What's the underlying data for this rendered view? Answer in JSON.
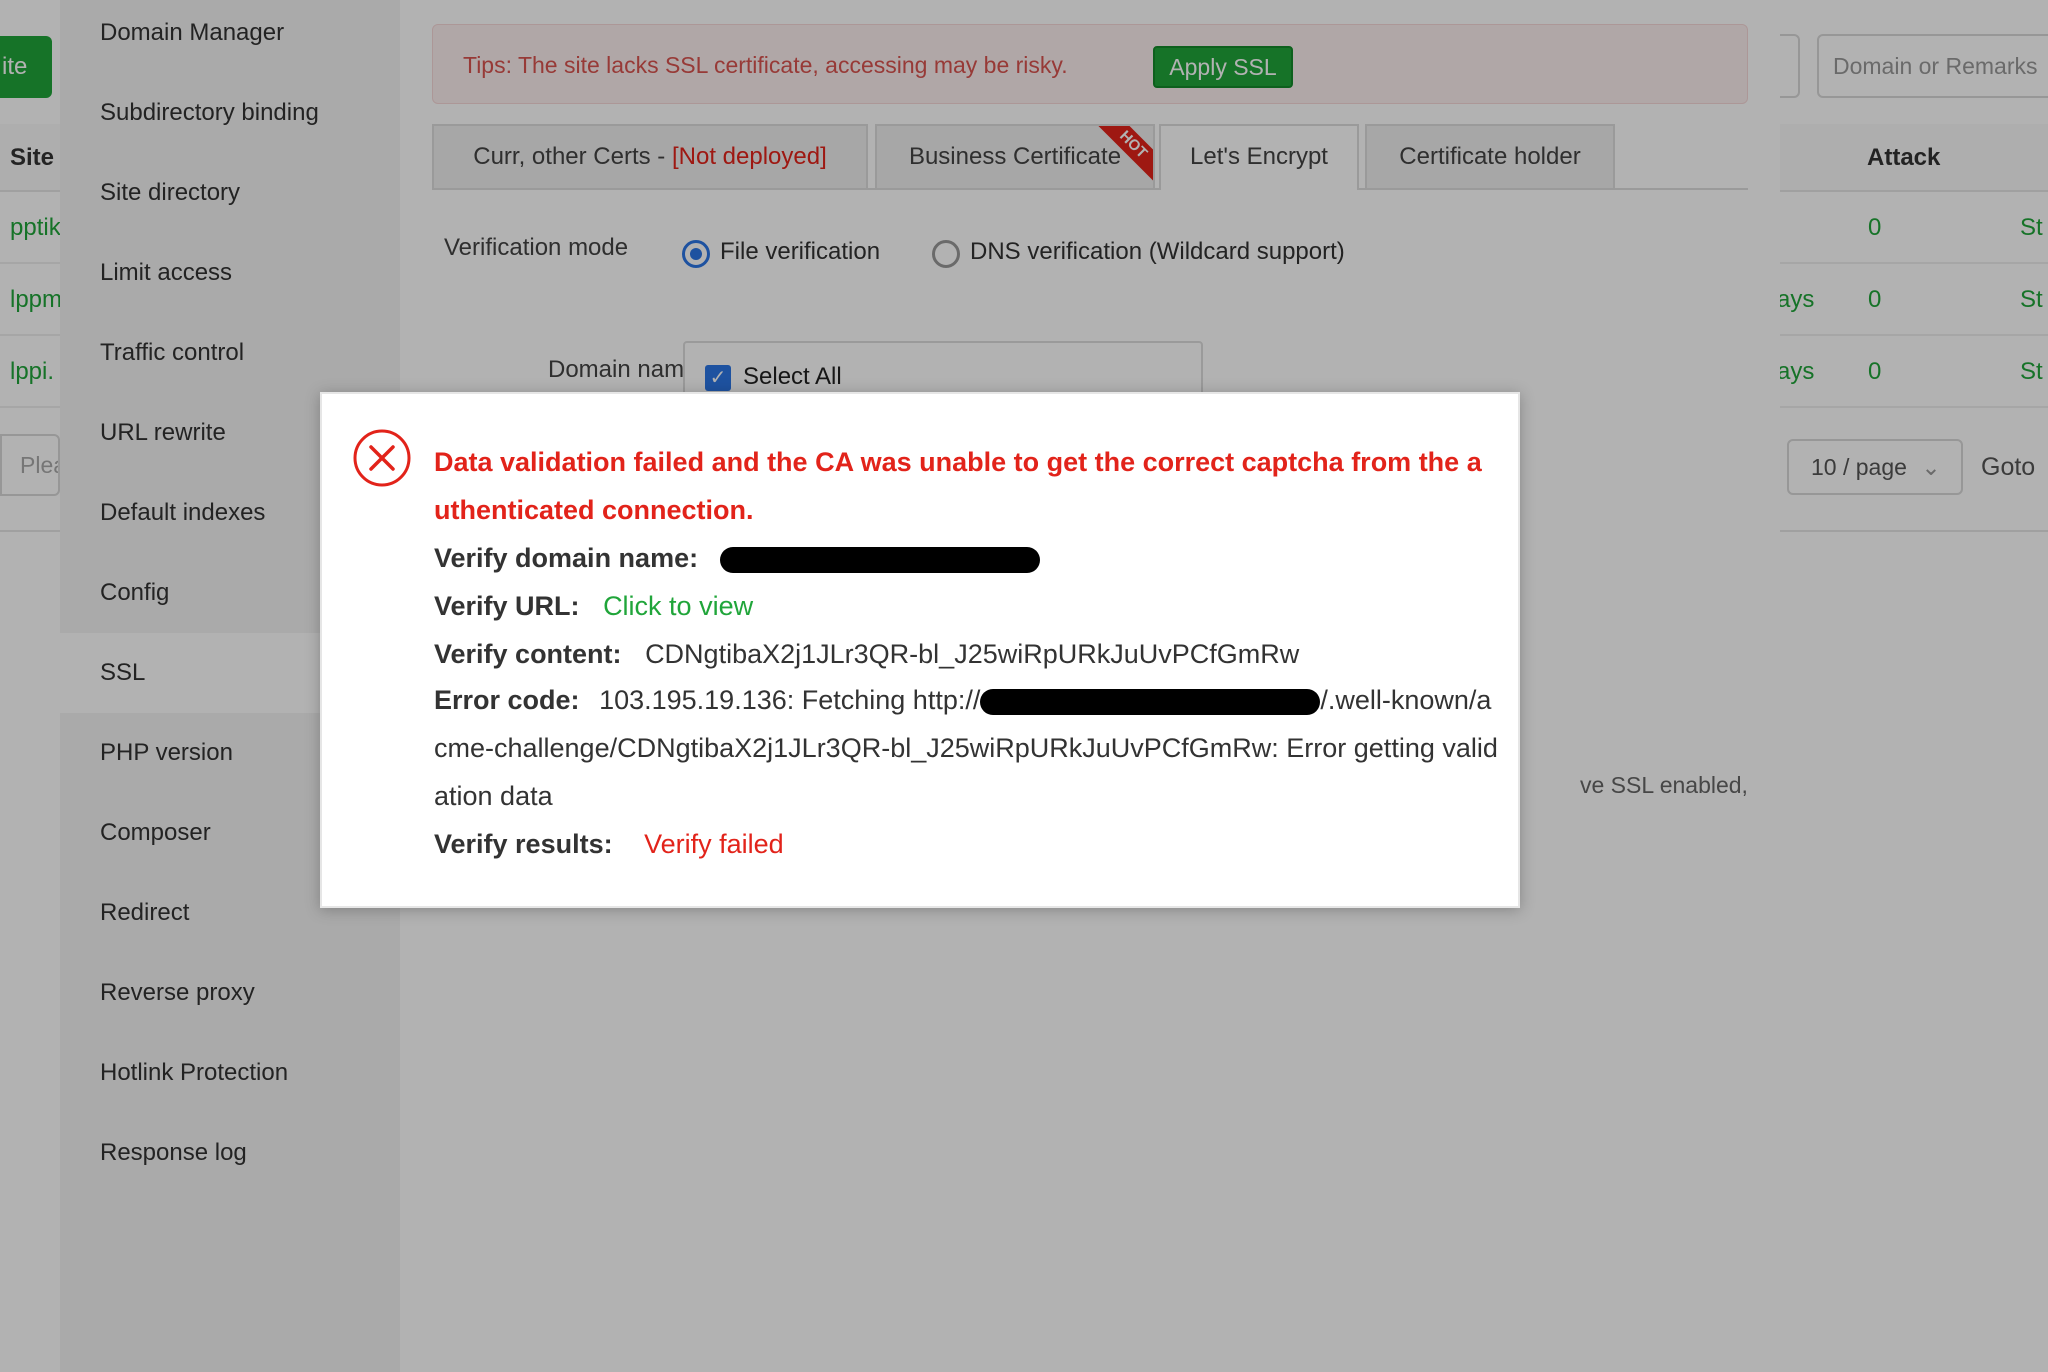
{
  "background": {
    "add_button_label": "ite",
    "search_placeholder": "Domain or Remarks",
    "columns": {
      "site": "Site",
      "attack": "Attack"
    },
    "rows": [
      {
        "site": "pptik",
        "expire": "",
        "attack": "0",
        "status": "St"
      },
      {
        "site": "lppm",
        "expire": "ays",
        "attack": "0",
        "status": "St"
      },
      {
        "site": "lppi.",
        "expire": "ays",
        "attack": "0",
        "status": "St"
      }
    ],
    "pager": {
      "input_placeholder": "Plea",
      "page_size": "10 / page",
      "goto_label": "Goto"
    }
  },
  "sidebar": {
    "items": [
      {
        "label": "Domain Manager"
      },
      {
        "label": "Subdirectory binding"
      },
      {
        "label": "Site directory"
      },
      {
        "label": "Limit access"
      },
      {
        "label": "Traffic control"
      },
      {
        "label": "URL rewrite"
      },
      {
        "label": "Default indexes"
      },
      {
        "label": "Config"
      },
      {
        "label": "SSL"
      },
      {
        "label": "PHP version"
      },
      {
        "label": "Composer"
      },
      {
        "label": "Redirect"
      },
      {
        "label": "Reverse proxy"
      },
      {
        "label": "Hotlink Protection"
      },
      {
        "label": "Response log"
      }
    ],
    "active": "SSL"
  },
  "ssl": {
    "tip_text": "Tips: The site lacks SSL certificate, accessing may be risky.",
    "apply_button": "Apply SSL",
    "tabs": {
      "curr_label": "Curr, other Certs - ",
      "curr_status": "[Not deployed]",
      "business": "Business Certificate",
      "hot_badge": "HOT",
      "letsencrypt": "Let's Encrypt",
      "holder": "Certificate holder"
    },
    "verification_mode_label": "Verification mode",
    "file_verification": "File verification",
    "dns_verification": "DNS verification (Wildcard support)",
    "domain_name_label": "Domain name",
    "select_all_label": "Select All",
    "ssl_note_fragment": "ve SSL enabled,"
  },
  "error_dialog": {
    "title": "Data validation failed and the CA was unable to get the correct captcha from the authenticated connection.",
    "verify_domain_label": "Verify domain name:",
    "verify_url_label": "Verify URL:",
    "verify_url_link": "Click to view",
    "verify_content_label": "Verify content:",
    "verify_content_value": "CDNgtibaX2j1JLr3QR-bl_J25wiRpURkJuUvPCfGmRw",
    "error_code_label": "Error code:",
    "error_code_prefix": "103.195.19.136: Fetching http://",
    "error_code_suffix": "/.well-known/acme-challenge/CDNgtibaX2j1JLr3QR-bl_J25wiRpURkJuUvPCfGmRw: Error getting validation data",
    "verify_results_label": "Verify results:",
    "verify_results_value": "Verify failed",
    "accent_red": "#e2231a",
    "accent_green": "#20a53a"
  }
}
